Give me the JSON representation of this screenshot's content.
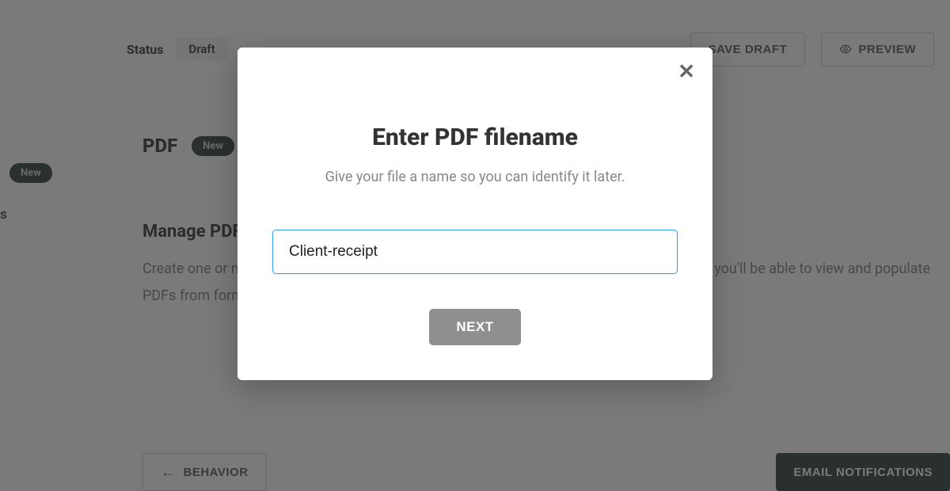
{
  "header": {
    "status_label": "Status",
    "status_value": "Draft",
    "save_draft_label": "SAVE DRAFT",
    "preview_label": "PREVIEW"
  },
  "sidebar": {
    "badge_label": "New",
    "cut_text": "s"
  },
  "content": {
    "pdf_heading": "PDF",
    "pdf_badge": "New",
    "section_title": "Manage PDFs",
    "section_body": "Create one or more templates that map your form fields to a PDF document. When you do, you'll be able to view and populate PDFs from form submissions."
  },
  "bottom_nav": {
    "back_label": "BEHAVIOR",
    "next_label": "EMAIL NOTIFICATIONS"
  },
  "modal": {
    "title": "Enter PDF filename",
    "subtitle": "Give your file a name so you can identify it later.",
    "input_value": "Client-receipt",
    "next_label": "NEXT"
  }
}
